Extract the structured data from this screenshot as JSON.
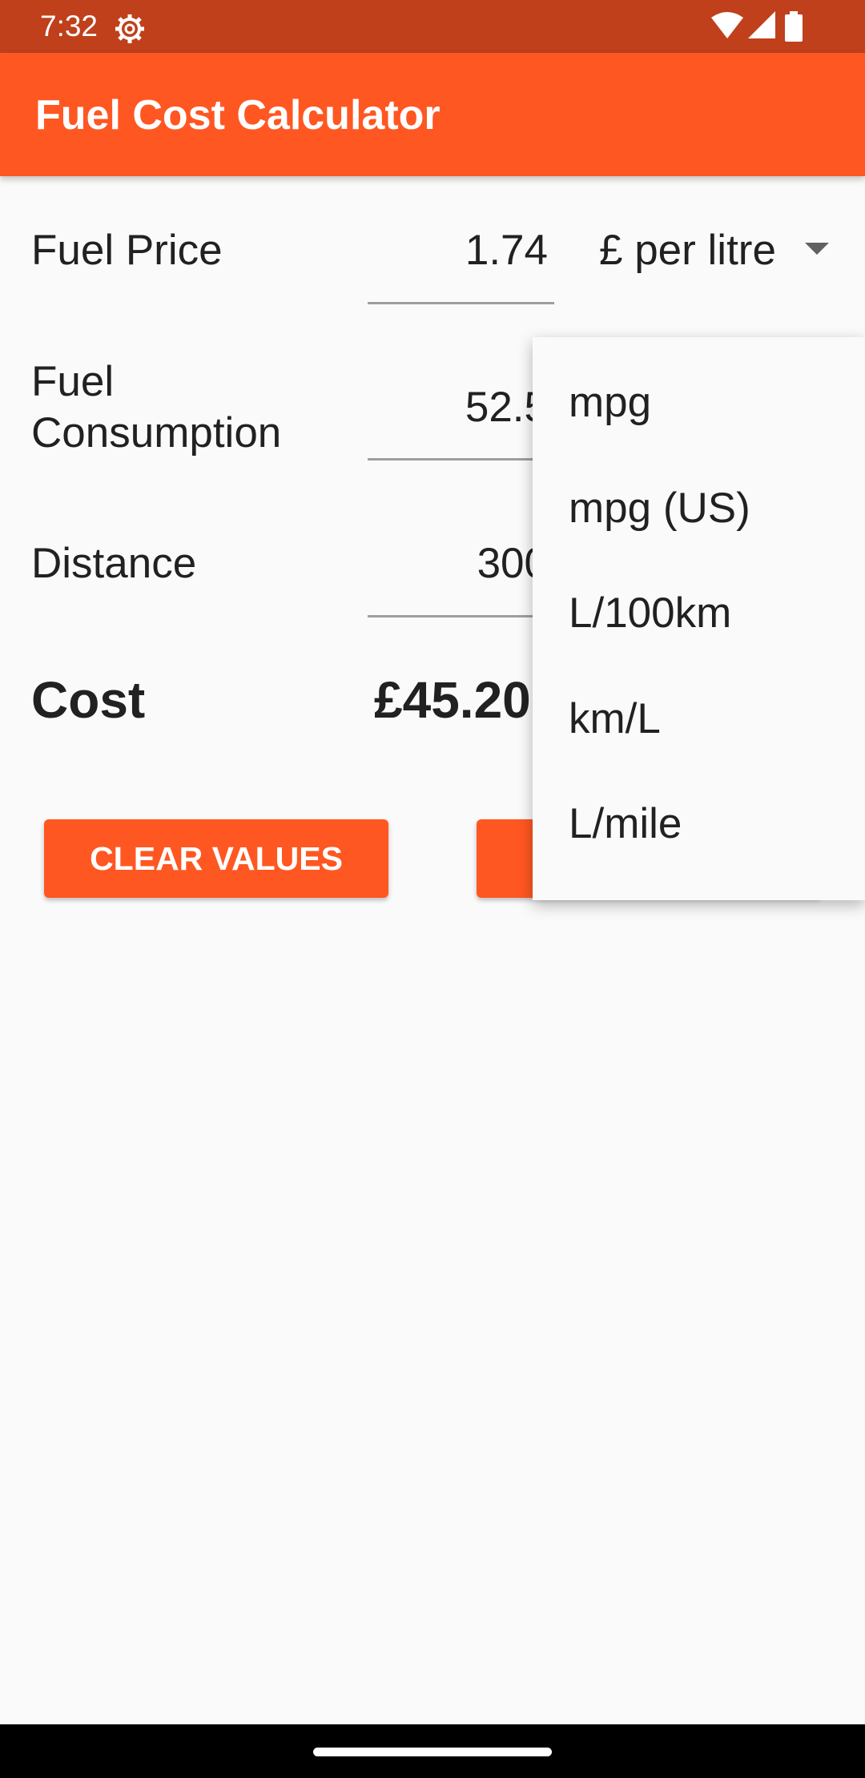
{
  "status_bar": {
    "time": "7:32",
    "icons": [
      "settings-icon",
      "wifi-icon",
      "signal-icon",
      "battery-icon"
    ]
  },
  "app_bar": {
    "title": "Fuel Cost Calculator",
    "color": "#ff5722"
  },
  "form": {
    "fuel_price": {
      "label": "Fuel Price",
      "value": "1.74",
      "unit": "£ per litre"
    },
    "fuel_consumption": {
      "label_line1": "Fuel",
      "label_line2": "Consumption",
      "value": "52.5"
    },
    "distance": {
      "label": "Distance",
      "value": "300"
    },
    "cost": {
      "label": "Cost",
      "value": "£45.20"
    }
  },
  "buttons": {
    "clear_label": "CLEAR VALUES"
  },
  "dropdown": {
    "options": [
      "mpg",
      "mpg (US)",
      "L/100km",
      "km/L",
      "L/mile"
    ]
  },
  "colors": {
    "accent": "#ff5722",
    "status_bar": "#bf401b",
    "background": "#fafafa"
  }
}
